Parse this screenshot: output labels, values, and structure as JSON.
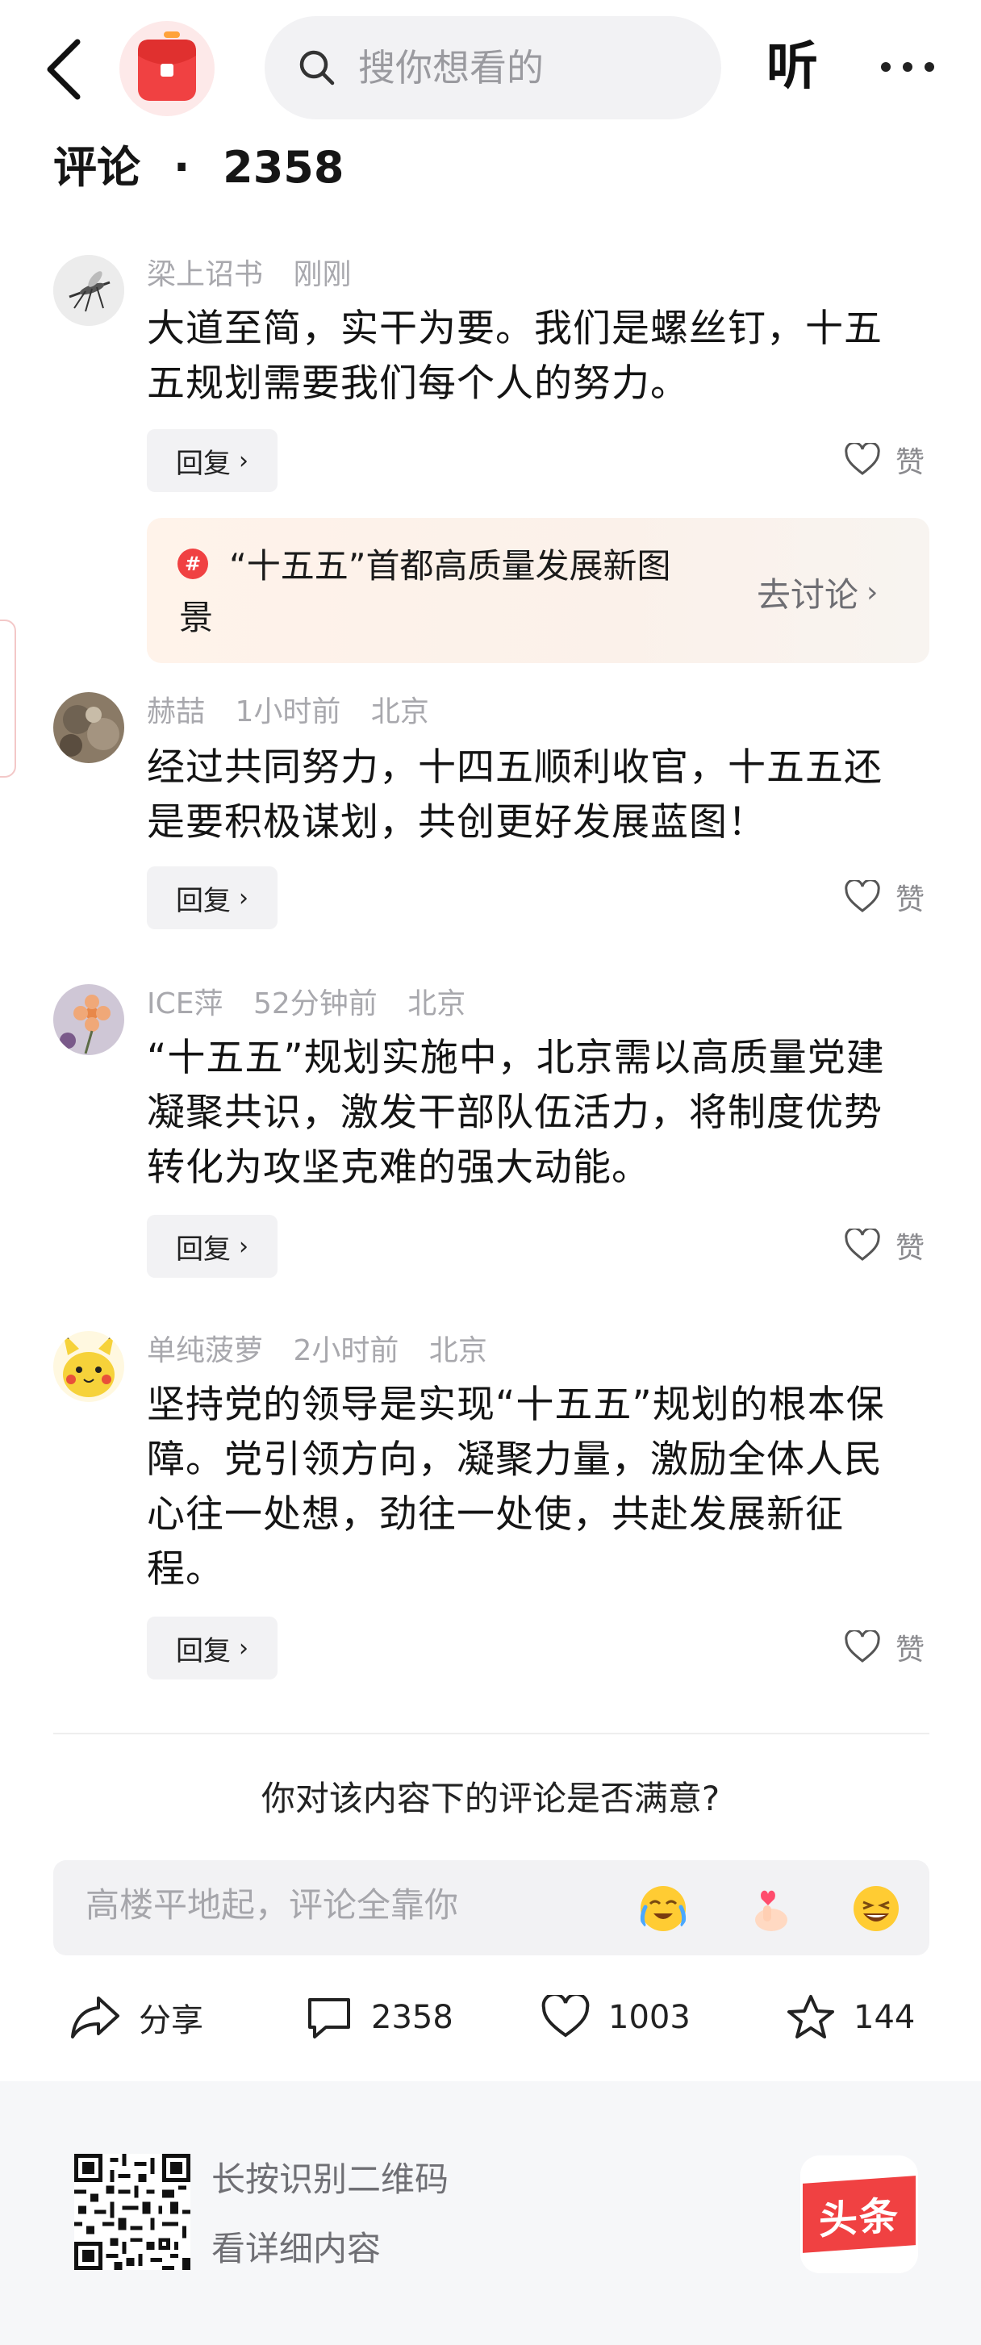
{
  "header": {
    "search_placeholder": "搜你想看的",
    "listen_label": "听"
  },
  "comments_section": {
    "title": "评论",
    "separator": "·",
    "count": "2358"
  },
  "comments": [
    {
      "author": "梁上诏书",
      "time": "刚刚",
      "location": "",
      "text": "大道至简，实干为要。我们是螺丝钉，十五五规划需要我们每个人的努力。",
      "reply_label": "回复",
      "like_label": "赞"
    },
    {
      "author": "赫喆",
      "time": "1小时前",
      "location": "北京",
      "text": "经过共同努力，十四五顺利收官，十五五还是要积极谋划，共创更好发展蓝图！",
      "reply_label": "回复",
      "like_label": "赞"
    },
    {
      "author": "ICE萍",
      "time": "52分钟前",
      "location": "北京",
      "text": "“十五五”规划实施中，北京需以高质量党建凝聚共识，激发干部队伍活力，将制度优势转化为攻坚克难的强大动能。",
      "reply_label": "回复",
      "like_label": "赞"
    },
    {
      "author": "单纯菠萝",
      "time": "2小时前",
      "location": "北京",
      "text": "坚持党的领导是实现“十五五”规划的根本保障。党引领方向，凝聚力量，激励全体人民心往一处想，劲往一处使，共赴发展新征程。",
      "reply_label": "回复",
      "like_label": "赞"
    }
  ],
  "topic_card": {
    "badge": "#",
    "text": "“十五五”首都高质量发展新图景",
    "link_label": "去讨论"
  },
  "survey": {
    "question": "你对该内容下的评论是否满意?"
  },
  "comment_input": {
    "placeholder": "高楼平地起，评论全靠你",
    "emojis": [
      "crying-laughing-emoji",
      "finger-heart-emoji",
      "grinning-emoji"
    ]
  },
  "actions": {
    "share_label": "分享",
    "comment_count": "2358",
    "like_count": "1003",
    "favorite_count": "144"
  },
  "footer": {
    "qr_line1": "长按识别二维码",
    "qr_line2": "看详细内容",
    "logo_text": "头条"
  },
  "colors": {
    "brand_red": "#f04142",
    "muted_text": "#a8a8ad",
    "input_bg": "#f2f2f4"
  }
}
